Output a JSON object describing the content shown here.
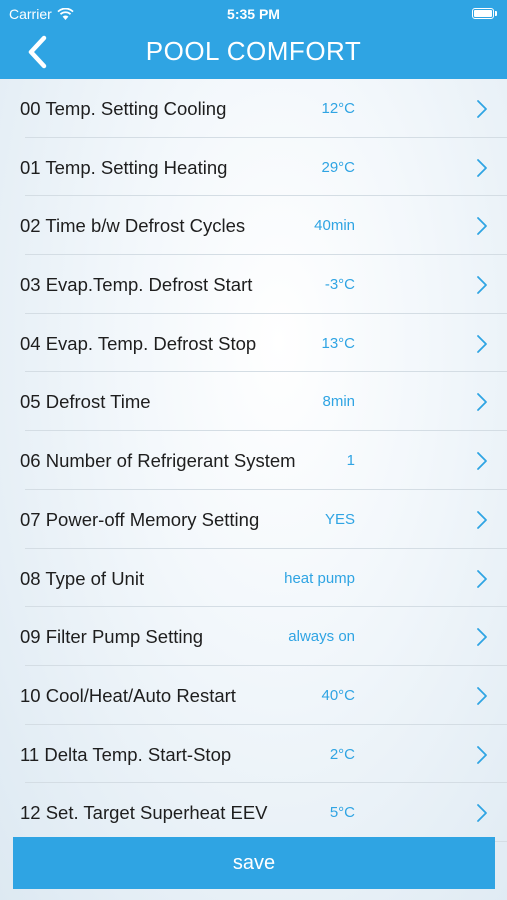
{
  "status_bar": {
    "carrier": "Carrier",
    "time": "5:35 PM",
    "icons": [
      "wifi-icon",
      "battery-icon"
    ]
  },
  "nav": {
    "back_icon": "chevron-left-icon",
    "title": "POOL COMFORT"
  },
  "colors": {
    "accent": "#2fa4e3",
    "label": "#1e1e1e",
    "separator": "#d4dde4"
  },
  "settings": [
    {
      "label": "00 Temp. Setting Cooling",
      "value": "12°C"
    },
    {
      "label": "01 Temp. Setting Heating",
      "value": "29°C"
    },
    {
      "label": "02 Time b/w Defrost Cycles",
      "value": "40min"
    },
    {
      "label": "03 Evap.Temp. Defrost Start",
      "value": "-3°C"
    },
    {
      "label": "04 Evap. Temp. Defrost Stop",
      "value": "13°C"
    },
    {
      "label": "05 Defrost Time",
      "value": "8min"
    },
    {
      "label": "06 Number of Refrigerant System",
      "value": "1"
    },
    {
      "label": "07 Power-off Memory Setting",
      "value": "YES"
    },
    {
      "label": "08 Type of Unit",
      "value": "heat pump"
    },
    {
      "label": "09 Filter Pump Setting",
      "value": "always on"
    },
    {
      "label": "10 Cool/Heat/Auto Restart",
      "value": "40°C"
    },
    {
      "label": "11 Delta Temp. Start-Stop",
      "value": "2°C"
    },
    {
      "label": "12 Set. Target Superheat EEV",
      "value": "5°C"
    }
  ],
  "save_label": "save"
}
